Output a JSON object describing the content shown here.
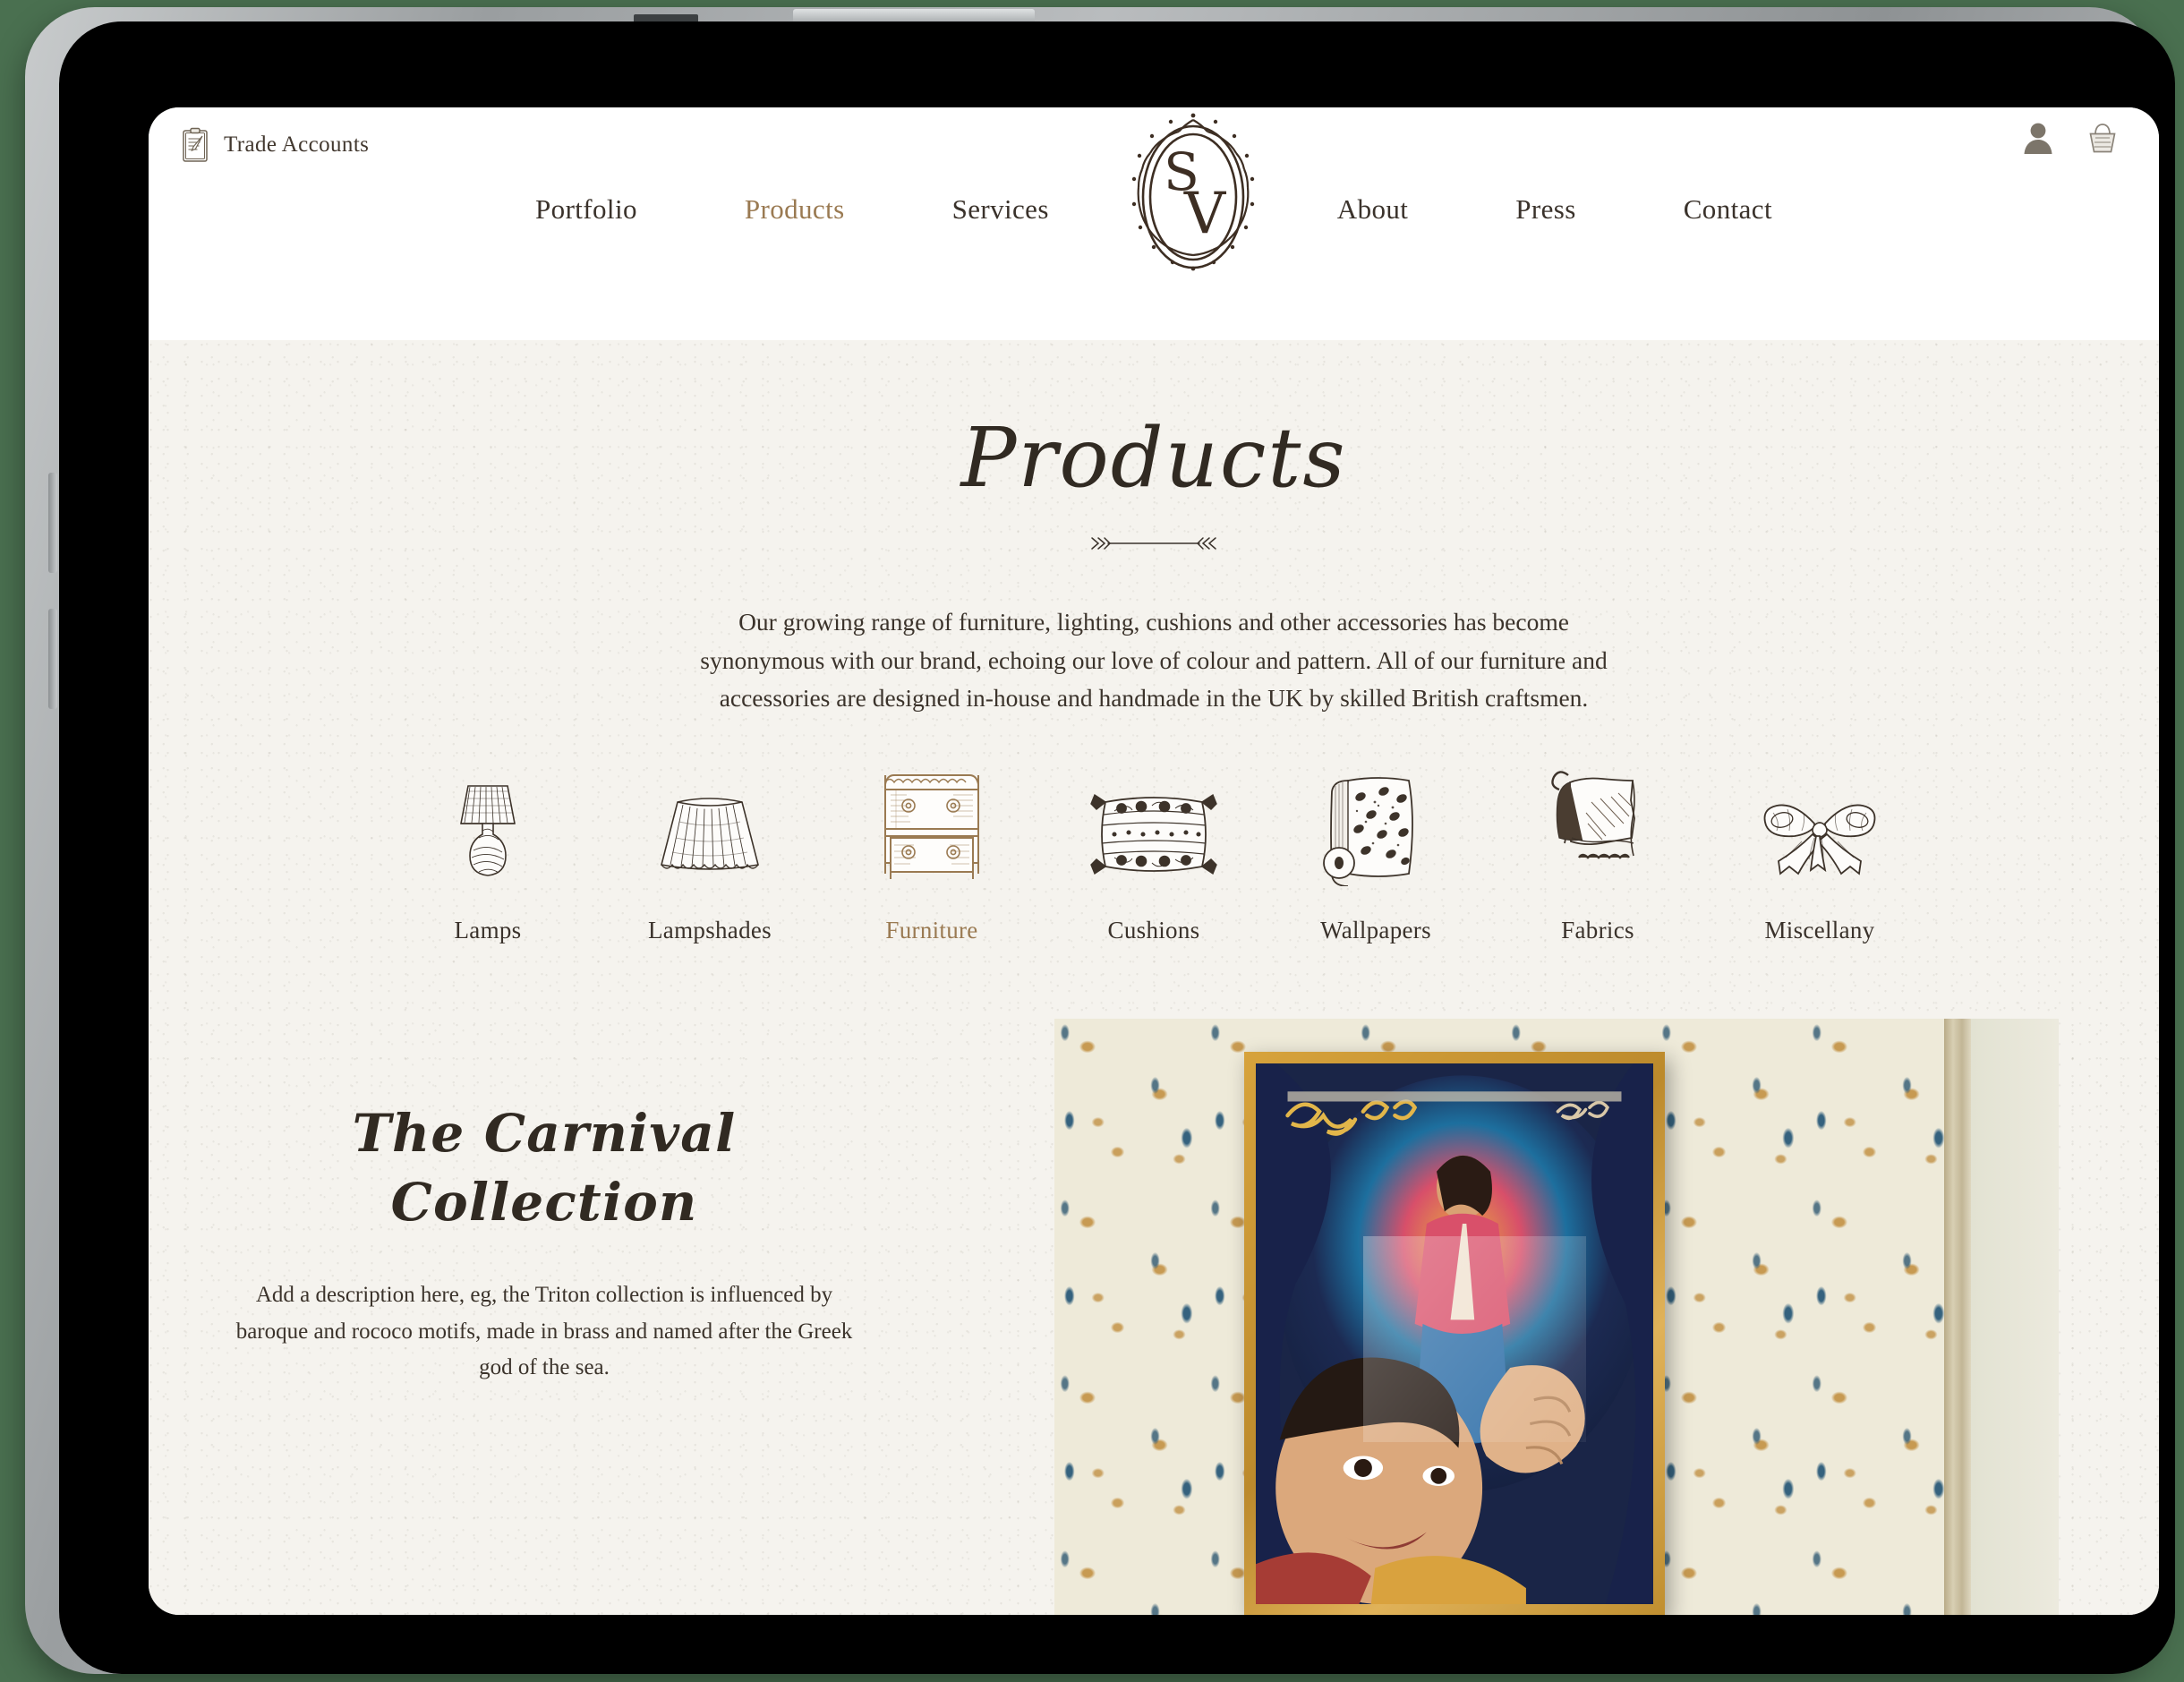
{
  "header": {
    "trade_accounts_label": "Trade Accounts",
    "trade_accounts_icon": "clipboard-icon",
    "account_icon": "account-person-icon",
    "basket_icon": "shopping-basket-icon",
    "logo_monogram": "SV",
    "logo_alt": "ornate-oval-sv-monogram"
  },
  "nav": {
    "left": [
      {
        "label": "Portfolio",
        "active": false
      },
      {
        "label": "Products",
        "active": true
      },
      {
        "label": "Services",
        "active": false
      }
    ],
    "right": [
      {
        "label": "About",
        "active": false
      },
      {
        "label": "Press",
        "active": false
      },
      {
        "label": "Contact",
        "active": false
      }
    ]
  },
  "hero": {
    "title": "Products",
    "divider_icon": "double-arrow-divider",
    "body": "Our growing range of furniture, lighting, cushions and other accessories has become synonymous with our brand, echoing our love of colour and pattern. All of our furniture and accessories are designed in-house and handmade in the UK by skilled British craftsmen."
  },
  "categories": [
    {
      "label": "Lamps",
      "icon": "table-lamp-icon",
      "active": false
    },
    {
      "label": "Lampshades",
      "icon": "lampshade-icon",
      "active": false
    },
    {
      "label": "Furniture",
      "icon": "side-table-icon",
      "active": true
    },
    {
      "label": "Cushions",
      "icon": "cushion-icon",
      "active": false
    },
    {
      "label": "Wallpapers",
      "icon": "wallpaper-roll-icon",
      "active": false
    },
    {
      "label": "Fabrics",
      "icon": "fabric-swatch-icon",
      "active": false
    },
    {
      "label": "Miscellany",
      "icon": "ribbon-bow-icon",
      "active": false
    }
  ],
  "collection": {
    "title_line_1": "The Carnival",
    "title_line_2": "Collection",
    "description": "Add a description here, eg, the Triton collection is influenced by baroque and rococo motifs, made in brass and named after the Greek god of the sea.",
    "photo_alt": "framed-vintage-film-poster-on-patterned-wallpaper"
  },
  "colors": {
    "accent_gold": "#9a7a52",
    "ink": "#3a322b",
    "page_bg": "#f5f3ee",
    "header_bg": "#ffffff",
    "scene_bg": "#4a7050"
  }
}
